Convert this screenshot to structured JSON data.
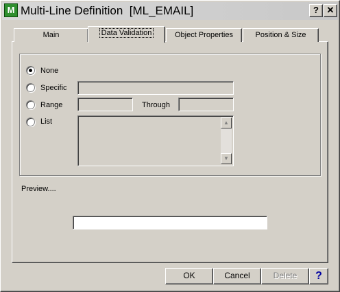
{
  "window": {
    "title": "Multi-Line Definition  [ML_EMAIL]",
    "app_icon": "M",
    "help_glyph": "?",
    "close_glyph": "✕"
  },
  "tabs": [
    {
      "label": "Main",
      "active": false
    },
    {
      "label": "Data Validation",
      "active": true
    },
    {
      "label": "Object Properties",
      "active": false
    },
    {
      "label": "Position & Size",
      "active": false
    }
  ],
  "validation": {
    "selected": "None",
    "options": {
      "none": "None",
      "specific": "Specific",
      "range": "Range",
      "list": "List"
    },
    "through_label": "Through",
    "specific_value": "",
    "range_from": "",
    "range_to": "",
    "list_items": []
  },
  "preview": {
    "label": "Preview....",
    "value": ""
  },
  "buttons": {
    "ok": "OK",
    "cancel": "Cancel",
    "delete": "Delete",
    "help": "?"
  },
  "colors": {
    "face": "#d4d0c8",
    "help_accent": "#0000a0",
    "app_icon": "#2f8f2f"
  }
}
